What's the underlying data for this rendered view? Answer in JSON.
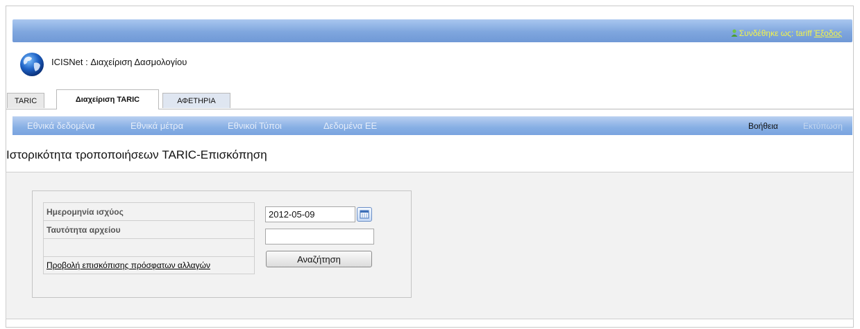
{
  "header": {
    "login_prefix": "Συνδέθηκε ως:",
    "username": "tariff",
    "logout": "Έξοδος",
    "app_title": "ICISNet : Διαχείριση Δασμολογίου",
    "login_color": "#f4f44a",
    "bar_color": "#7fa6de"
  },
  "tabs": [
    {
      "label": "TARIC"
    },
    {
      "label": "Διαχείριση TARIC",
      "active": true
    },
    {
      "label": "ΑΦΕΤΗΡΙΑ"
    }
  ],
  "nav": {
    "items": [
      "Εθνικά δεδομένα",
      "Εθνικά μέτρα",
      "Εθνικοί Τύποι",
      "Δεδομένα ΕΕ"
    ],
    "help": "Βοήθεια",
    "print": "Εκτύπωση"
  },
  "page": {
    "title": "Ιστορικότητα τροποποιήσεων TARIC-Επισκόπηση"
  },
  "form": {
    "date_label": "Ημερομηνία ισχύος",
    "date_value": "2012-05-09",
    "file_label": "Ταυτότητα αρχείου",
    "file_value": "",
    "search_button": "Αναζήτηση",
    "recent_changes_link": "Προβολή επισκόπισης πρόσφατων αλλαγών"
  },
  "icons": [
    "user-icon",
    "globe-logo-icon",
    "calendar-icon"
  ]
}
